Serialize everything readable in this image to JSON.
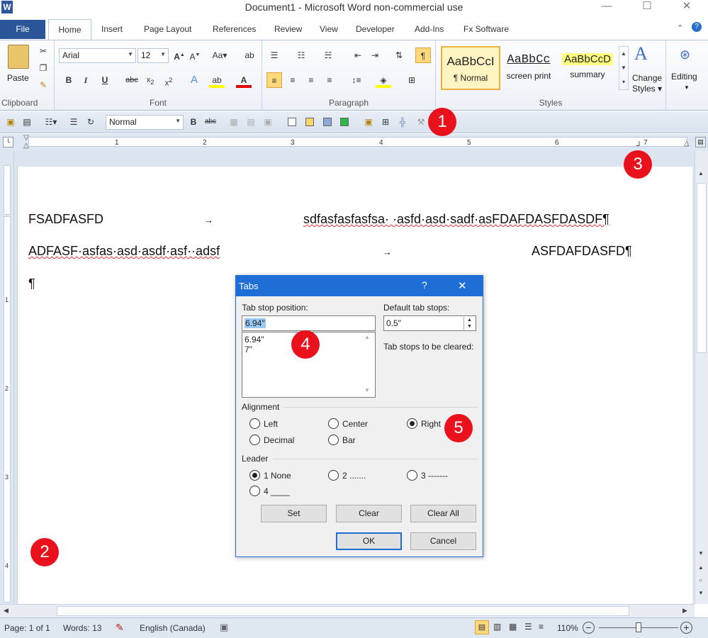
{
  "window": {
    "title": "Document1  -  Microsoft Word non-commercial use",
    "min": "—",
    "max": "☐",
    "close": "✕"
  },
  "ribbon_tabs": [
    "File",
    "Home",
    "Insert",
    "Page Layout",
    "References",
    "Review",
    "View",
    "Developer",
    "Add-Ins",
    "Fx Software"
  ],
  "ribbon": {
    "clipboard": {
      "paste": "Paste",
      "label": "Clipboard"
    },
    "font": {
      "name": "Arial",
      "size": "12",
      "label": "Font"
    },
    "paragraph": {
      "label": "Paragraph"
    },
    "styles": {
      "label": "Styles",
      "items": [
        {
          "preview": "AaBbCcI",
          "name": "¶ Normal"
        },
        {
          "preview": "AaBbCc",
          "name": "screen print"
        },
        {
          "preview": "AaBbCcD",
          "name": "summary"
        }
      ],
      "change": [
        "Change",
        "Styles"
      ]
    },
    "editing": {
      "label": "Editing"
    }
  },
  "qat": {
    "style_value": "Normal"
  },
  "ruler": {
    "numbers": [
      "1",
      "2",
      "3",
      "4",
      "5",
      "6",
      "7"
    ]
  },
  "document": {
    "line1_left": "FSADFASFD",
    "line1_right": "sdfasfasfasfsa· ·asfd·asd·sadf·asFDAFDASFDASDF¶",
    "line2_left": "ADFASF·asfas·asd·asdf·asf··adsf",
    "line2_right": "ASFDAFDASFD¶",
    "line3": "¶",
    "tab_arrow": "→"
  },
  "badges": [
    "1",
    "2",
    "3",
    "4",
    "5"
  ],
  "dialog": {
    "title": "Tabs",
    "help": "?",
    "close": "✕",
    "tab_stop_label": "Tab stop position:",
    "tab_stop_value": "6.94\"",
    "tab_stops": [
      "6.94\"",
      "7\""
    ],
    "default_label": "Default tab stops:",
    "default_value": "0.5\"",
    "cleared_label": "Tab stops to be cleared:",
    "alignment_label": "Alignment",
    "alignment": {
      "left": "Left",
      "center": "Center",
      "right": "Right",
      "decimal": "Decimal",
      "bar": "Bar",
      "selected": "Right"
    },
    "leader_label": "Leader",
    "leader": {
      "l1": "1 None",
      "l2": "2 .......",
      "l3": "3 -------",
      "l4": "4 ____",
      "selected": "1 None"
    },
    "buttons": {
      "set": "Set",
      "clear": "Clear",
      "clear_all": "Clear All",
      "ok": "OK",
      "cancel": "Cancel"
    }
  },
  "status": {
    "page": "Page: 1 of 1",
    "words": "Words: 13",
    "language": "English (Canada)",
    "zoom": "110%"
  }
}
